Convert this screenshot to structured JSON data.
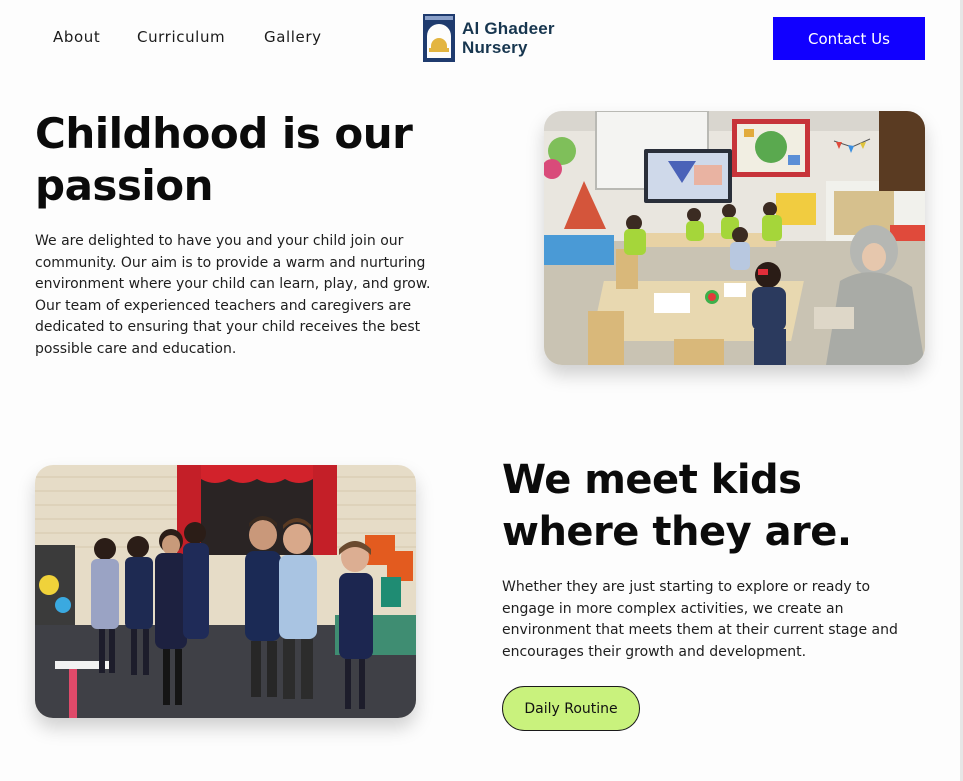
{
  "header": {
    "nav": [
      {
        "label": "About"
      },
      {
        "label": "Curriculum"
      },
      {
        "label": "Gallery"
      }
    ],
    "logo": {
      "line1": "Al Ghadeer",
      "line2": "Nursery",
      "icon": "mosque-dome-logo-icon"
    },
    "contact_label": "Contact Us"
  },
  "hero": {
    "title": "Childhood is our passion",
    "text": "We are delighted to have you and your child join our community. Our aim is to provide a warm and nurturing environment where your child can learn, play, and grow. Our team of experienced teachers and caregivers are dedicated to ensuring that your child receives the best possible care and education.",
    "image": "classroom-photo"
  },
  "meet": {
    "title": "We meet kids where they are.",
    "text": "Whether they are just starting to explore or ready to engage in more complex activities, we create an environment that meets them at their current stage and encourages their growth and development.",
    "button_label": "Daily Routine",
    "image": "children-singing-photo"
  },
  "colors": {
    "contact_button": "#1100ff",
    "routine_button": "#c9f27d",
    "logo_text": "#17364f",
    "background": "#fdfdfd"
  }
}
